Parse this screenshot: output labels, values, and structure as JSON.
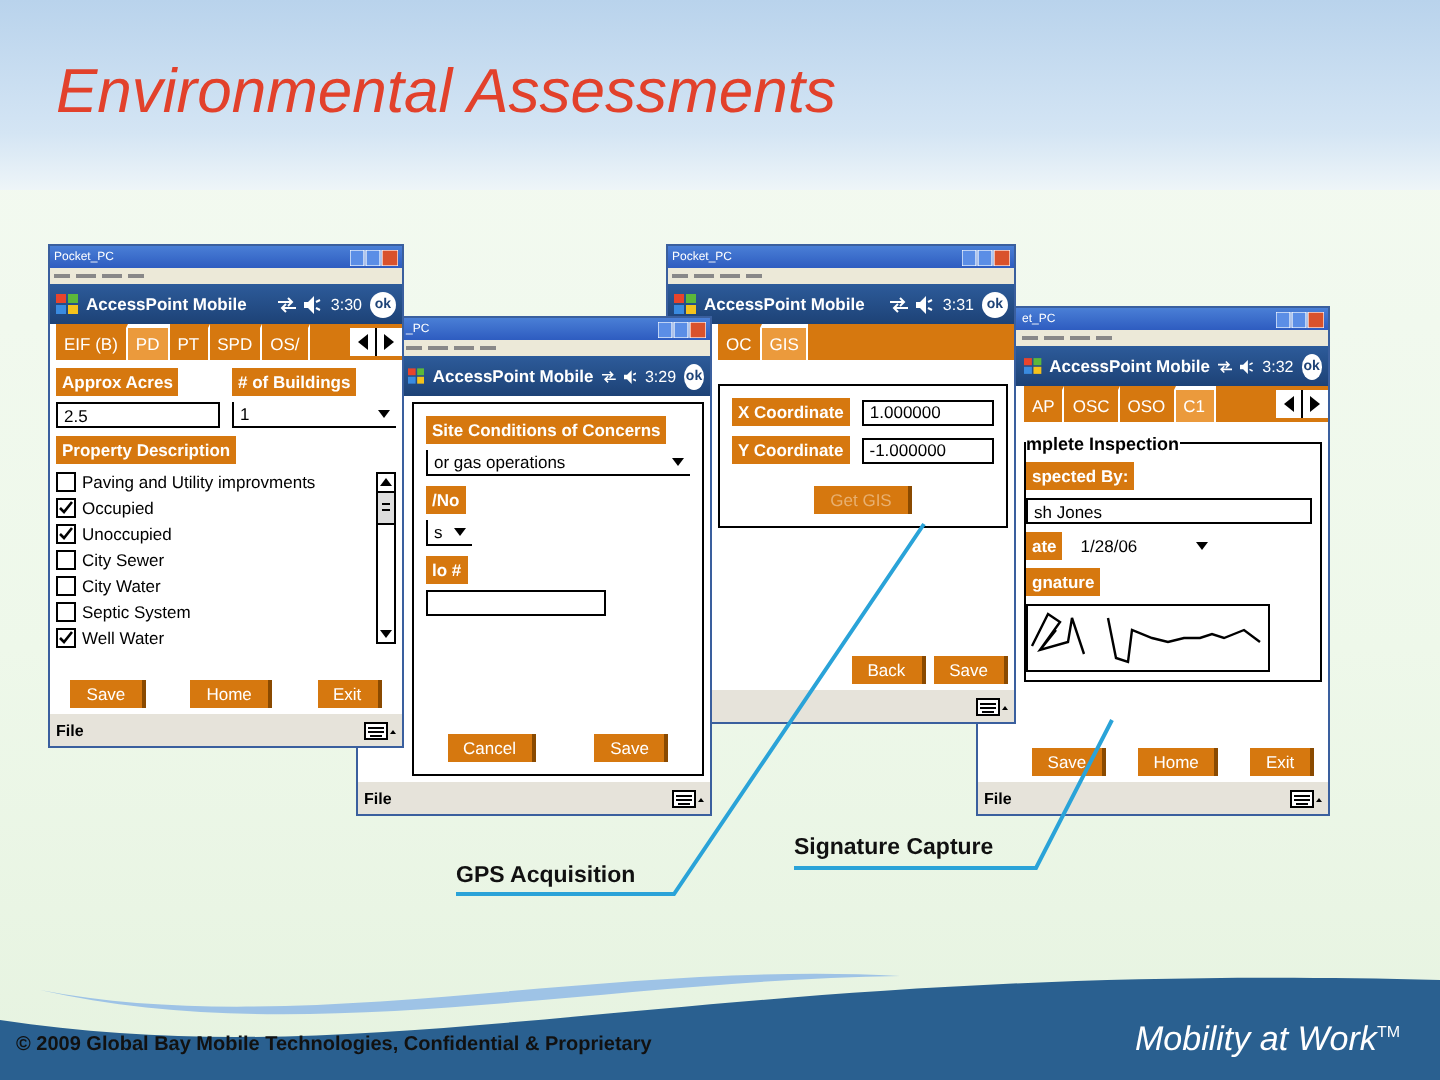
{
  "slide": {
    "title": "Environmental Assessments"
  },
  "windows": [
    {
      "kind": "property",
      "title": "Pocket_PC",
      "app": "AccessPoint Mobile",
      "time": "3:30",
      "ok": "ok",
      "menu": "File",
      "tabs": [
        {
          "label": "EIF (B)",
          "selected": false
        },
        {
          "label": "PD",
          "selected": true
        },
        {
          "label": "PT",
          "selected": false
        },
        {
          "label": "SPD",
          "selected": false
        },
        {
          "label": "OS/",
          "selected": false
        }
      ],
      "fields": [
        {
          "label": "Approx Acres",
          "value": "2.5"
        },
        {
          "label": "# of Buildings",
          "value": "1"
        }
      ],
      "section": "Property Description",
      "checklist": [
        {
          "label": "Paving and Utility improvments",
          "checked": false
        },
        {
          "label": "Occupied",
          "checked": true
        },
        {
          "label": "Unoccupied",
          "checked": true
        },
        {
          "label": "City Sewer",
          "checked": false
        },
        {
          "label": "City Water",
          "checked": false
        },
        {
          "label": "Septic System",
          "checked": false
        },
        {
          "label": "Well Water",
          "checked": true
        }
      ],
      "buttons": [
        "Save",
        "Home",
        "Exit"
      ]
    },
    {
      "kind": "site",
      "title": "_PC",
      "app": "AccessPoint Mobile",
      "time": "3:29",
      "ok": "ok",
      "menu": "File",
      "fields": [
        {
          "label": "Site Conditions of Concerns",
          "value": "or gas operations",
          "kind": "dropdown"
        },
        {
          "label": "/No",
          "value": "s",
          "kind": "dropdown"
        },
        {
          "label": "lo #",
          "kind": "input"
        }
      ],
      "buttons": [
        "Cancel",
        "Save"
      ]
    },
    {
      "kind": "gis",
      "title": "Pocket_PC",
      "app": "AccessPoint Mobile",
      "time": "3:31",
      "ok": "ok",
      "tabs": [
        {
          "label": "OC",
          "selected": false
        },
        {
          "label": "GIS",
          "selected": true
        }
      ],
      "fields": [
        {
          "label": "X Coordinate",
          "value": "1.000000"
        },
        {
          "label": "Y Coordinate",
          "value": "-1.000000"
        }
      ],
      "action": {
        "label": "Get GIS",
        "disabled": true
      },
      "buttons": [
        "Back",
        "Save"
      ]
    },
    {
      "kind": "inspection",
      "title": "et_PC",
      "app": "AccessPoint Mobile",
      "time": "3:32",
      "ok": "ok",
      "menu": "File",
      "tabs": [
        {
          "label": "AP",
          "selected": false
        },
        {
          "label": "OSC",
          "selected": false
        },
        {
          "label": "OSO",
          "selected": false
        },
        {
          "label": "C1",
          "selected": true
        }
      ],
      "group": "mplete Inspection",
      "fields": [
        {
          "label": "spected By:",
          "value": "sh Jones"
        },
        {
          "label": "ate",
          "value": "1/28/06"
        },
        {
          "label": "gnature"
        }
      ],
      "buttons": [
        "Save",
        "Home",
        "Exit"
      ]
    }
  ],
  "callouts": [
    {
      "label": "GPS Acquisition"
    },
    {
      "label": "Signature Capture"
    }
  ],
  "footer": {
    "copyright": "© 2009 Global Bay Mobile Technologies, Confidential & Proprietary",
    "tagline": "Mobility at Work",
    "trademark": "TM"
  }
}
